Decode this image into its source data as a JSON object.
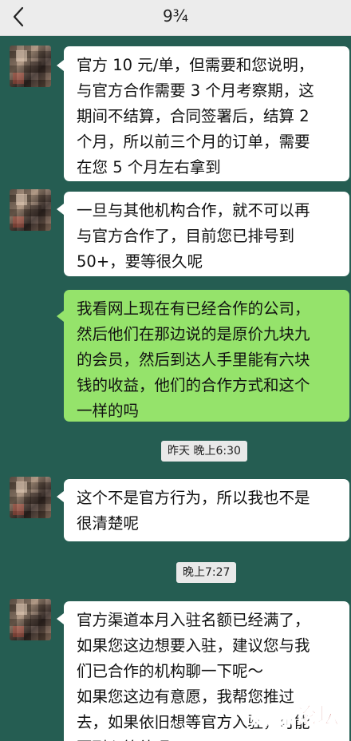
{
  "header": {
    "title": "9¾",
    "back_icon": "chevron-left-icon"
  },
  "colors": {
    "chat_background": "#255d52",
    "incoming_bubble": "#ffffff",
    "outgoing_bubble": "#95e36b",
    "timestamp_background": "#e9e9e9",
    "watermark": "#b3261e"
  },
  "messages": [
    {
      "side": "incoming",
      "text": "官方 10 元/单，但需要和您说明，\n与官方合作需要 3 个月考察期，这\n期间不结算，合同签署后，结算 2\n个月，所以前三个月的订单，需要\n在您 5 个月左右拿到"
    },
    {
      "side": "incoming",
      "text": "一旦与其他机构合作，就不可以再\n与官方合作了，目前您已排号到\n50+，要等很久呢"
    },
    {
      "side": "outgoing",
      "text": "我看网上现在有已经合作的公司，\n然后他们在那边说的是原价九块九\n的会员，然后到达人手里能有六块\n钱的收益，他们的合作方式和这个\n一样的吗"
    },
    {
      "side": "incoming",
      "text": "这个不是官方行为，所以我也不是\n很清楚呢"
    },
    {
      "side": "incoming",
      "text": "官方渠道本月入驻名额已经满了，\n如果您这边想要入驻，建议您与我\n们已合作的机构聊一下呢～\n如果您这边有意愿，我帮您推过\n去，如果依旧想等官方入驻，可能\n要耐心等待呢"
    }
  ],
  "timestamps": [
    "昨天 晚上6:30",
    "晚上7:27"
  ],
  "watermark": "赚赚论坛"
}
